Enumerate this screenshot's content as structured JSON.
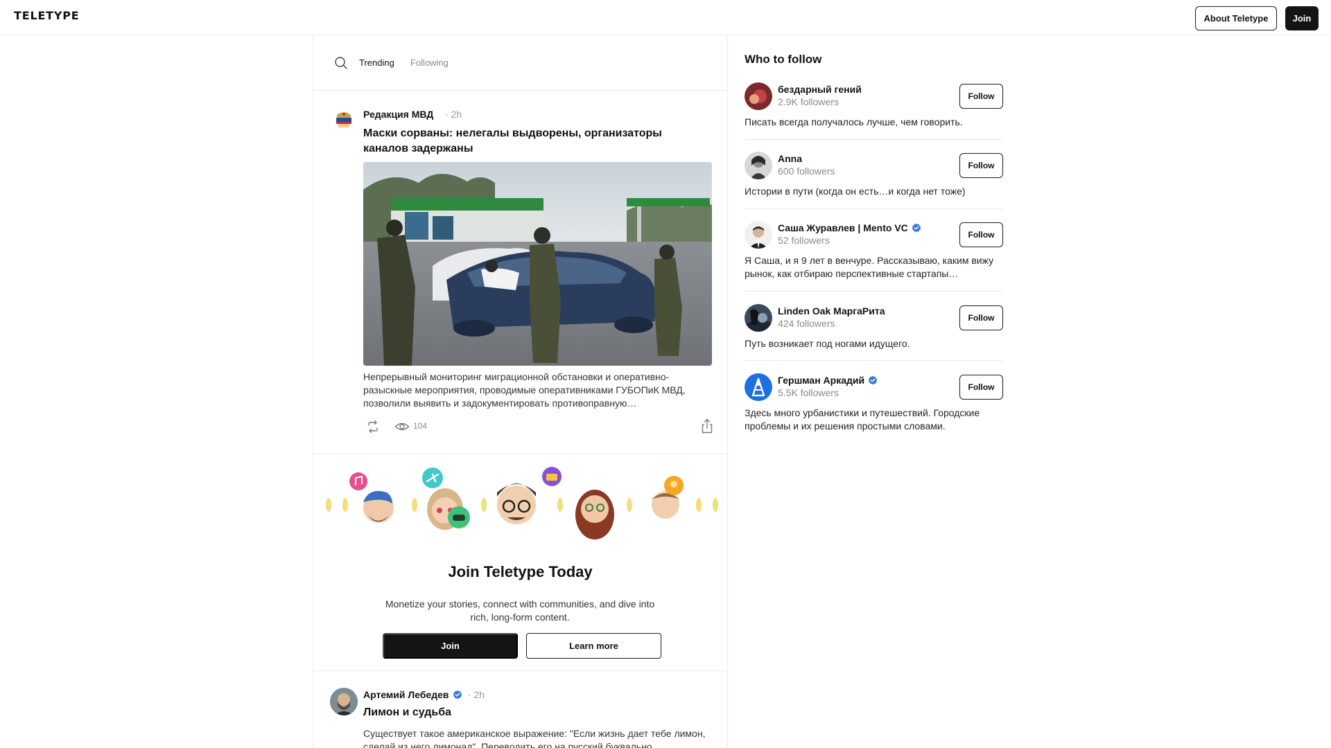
{
  "header": {
    "logo": "TELETYPE",
    "about_label": "About Teletype",
    "join_label": "Join"
  },
  "feed": {
    "tabs": [
      {
        "label": "Trending",
        "active": true
      },
      {
        "label": "Following",
        "active": false
      }
    ],
    "posts": [
      {
        "author": "Редакция МВД",
        "time": "· 2h",
        "title": "Маски сорваны: нелегалы выдворены, организаторы каналов задержаны",
        "excerpt": "Непрерывный мониторинг миграционной обстановки и оперативно-разыскные мероприятия, проводимые оперативниками ГУБОПиК МВД, позволили выявить и задокументировать противоправную…",
        "views": "104"
      },
      {
        "author": "Артемий Лебедев",
        "time": "· 2h",
        "title": "Лимон и судьба",
        "excerpt": "Существует такое американское выражение: \"Если жизнь дает тебе лимон, сделай из него лимонад\". Переводить его на русский буквально"
      }
    ],
    "promo": {
      "title": "Join Teletype Today",
      "text": "Monetize your stories, connect with communities, and dive into rich, long-form content.",
      "join_label": "Join",
      "learn_label": "Learn more"
    }
  },
  "who_to_follow": {
    "title": "Who to follow",
    "follow_label": "Follow",
    "items": [
      {
        "name": "бездарный гений",
        "followers": "2.9K followers",
        "bio": "Писать всегда получалось лучше, чем говорить.",
        "verified": false
      },
      {
        "name": "Anna",
        "followers": "600 followers",
        "bio": "Истории в пути (когда он есть…и когда нет тоже)",
        "verified": false
      },
      {
        "name": "Саша Журавлев | Mento VC",
        "followers": "52 followers",
        "bio": "Я Саша, и я 9 лет в венчуре. Рассказываю, каким вижу рынок, как отбираю перспективные стартапы…",
        "verified": true
      },
      {
        "name": "Linden Oak МаргаРита",
        "followers": "424 followers",
        "bio": "Путь возникает под ногами идущего.",
        "verified": false
      },
      {
        "name": "Гершман Аркадий",
        "followers": "5.5K followers",
        "bio": "Здесь много урбанистики и путешествий. Городские проблемы и их решения простыми словами.",
        "verified": true
      }
    ]
  },
  "colors": {
    "accent_dark": "#141414",
    "verified_blue": "#3a7bd5",
    "muted_text": "#8a8a8a",
    "divider": "#ebebeb"
  },
  "icons": [
    "search-icon",
    "repost-icon",
    "views-icon",
    "share-icon",
    "verified-icon",
    "music-badge-icon",
    "plane-badge-icon",
    "gamepad-badge-icon",
    "camera-badge-icon",
    "bulb-badge-icon"
  ]
}
